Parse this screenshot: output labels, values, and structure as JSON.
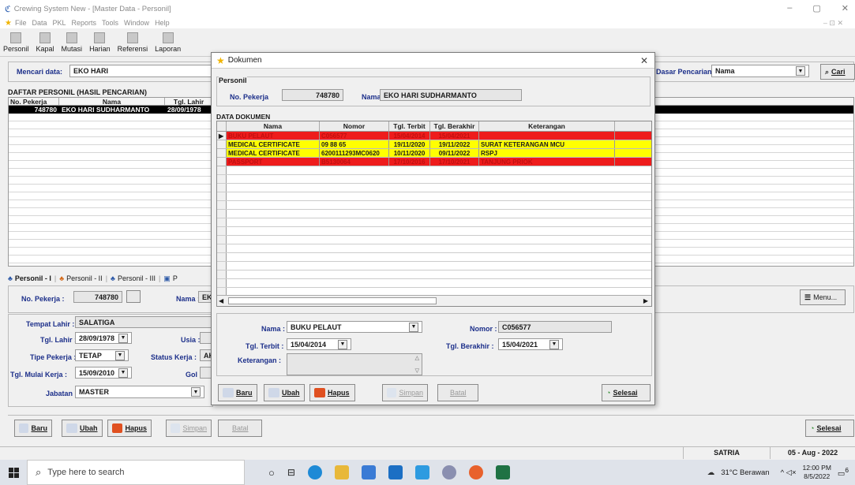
{
  "window": {
    "title": "Crewing System New - [Master Data - Personil]",
    "controls": [
      "–",
      "▢",
      "✕"
    ],
    "mdi_controls": "– ⊡ ✕"
  },
  "menu": [
    "File",
    "Data",
    "PKL",
    "Reports",
    "Tools",
    "Window",
    "Help"
  ],
  "toolbar": [
    "Personil",
    "Kapal",
    "Mutasi",
    "Harian",
    "Referensi",
    "Laporan"
  ],
  "search": {
    "label": "Mencari data:",
    "value": "EKO HARI",
    "by_label": "Dasar Pencarian:",
    "by_value": "Nama",
    "button": "Cari"
  },
  "list": {
    "title": "DAFTAR PERSONIL (HASIL PENCARIAN)",
    "columns": [
      "No. Pekerja",
      "Nama",
      "Tgl. Lahir"
    ],
    "rows": [
      [
        "748780",
        "EKO HARI SUDHARMANTO",
        "28/09/1978"
      ]
    ]
  },
  "tabs": [
    "Personil - I",
    "Personil - II",
    "Personil - III",
    "P"
  ],
  "personil": {
    "no_label": "No. Pekerja :",
    "no_value": "748780",
    "nama_label": "Nama :",
    "nama_value": "EK",
    "tempat_label": "Tempat Lahir :",
    "tempat_value": "SALATIGA",
    "tgl_lahir_label": "Tgl. Lahir :",
    "tgl_lahir_value": "28/09/1978",
    "usia_label": "Usia :",
    "tipe_label": "Tipe Pekerja :",
    "tipe_value": "TETAP",
    "status_label": "Status Kerja :",
    "status_value": "AK",
    "mulai_label": "Tgl. Mulai Kerja :",
    "mulai_value": "15/09/2010",
    "gol_label": "Gol :",
    "jabatan_label": "Jabatan :",
    "jabatan_value": "MASTER",
    "menu_button": "Menu..."
  },
  "main_buttons": {
    "baru": "Baru",
    "ubah": "Ubah",
    "hapus": "Hapus",
    "simpan": "Simpan",
    "batal": "Batal",
    "selesai": "Selesai"
  },
  "statusbar": {
    "user": "SATRIA",
    "date": "05 - Aug - 2022"
  },
  "dialog": {
    "title": "Dokumen",
    "personil_group": "Personil",
    "no_label": "No. Pekerja",
    "no_value": "748780",
    "nama_label": "Nama",
    "nama_value": "EKO HARI SUDHARMANTO",
    "data_title": "DATA DOKUMEN",
    "columns": [
      "Nama",
      "Nomor",
      "Tgl. Terbit",
      "Tgl. Berakhir",
      "Keterangan"
    ],
    "rows": [
      {
        "nama": "BUKU PELAUT",
        "nomor": "C056577",
        "terbit": "15/04/2014",
        "berakhir": "15/04/2021",
        "ket": "",
        "color": "#ee1c1c"
      },
      {
        "nama": "MEDICAL CERTIFICATE",
        "nomor": "09 88 65",
        "terbit": "19/11/2020",
        "berakhir": "19/11/2022",
        "ket": "SURAT KETERANGAN MCU",
        "color": "#ffff00"
      },
      {
        "nama": "MEDICAL CERTIFICATE",
        "nomor": "6200111293MC0620",
        "terbit": "10/11/2020",
        "berakhir": "09/11/2022",
        "ket": "RSPJ",
        "color": "#ffff00"
      },
      {
        "nama": "PASSPORT",
        "nomor": "B5130064",
        "terbit": "17/10/2016",
        "berakhir": "17/10/2021",
        "ket": "TANJUNG PRIOK",
        "color": "#ee1c1c"
      }
    ],
    "form": {
      "nama_label": "Nama :",
      "nama_value": "BUKU PELAUT",
      "nomor_label": "Nomor :",
      "nomor_value": "C056577",
      "terbit_label": "Tgl. Terbit :",
      "terbit_value": "15/04/2014",
      "berakhir_label": "Tgl. Berakhir :",
      "berakhir_value": "15/04/2021",
      "ket_label": "Keterangan :"
    },
    "buttons": {
      "baru": "Baru",
      "ubah": "Ubah",
      "hapus": "Hapus",
      "simpan": "Simpan",
      "batal": "Batal",
      "selesai": "Selesai"
    }
  },
  "taskbar": {
    "search_placeholder": "Type here to search",
    "weather": "31°C  Berawan",
    "tray": "^ ◁×",
    "time": "12:00 PM",
    "date": "8/5/2022",
    "notif": "6"
  }
}
